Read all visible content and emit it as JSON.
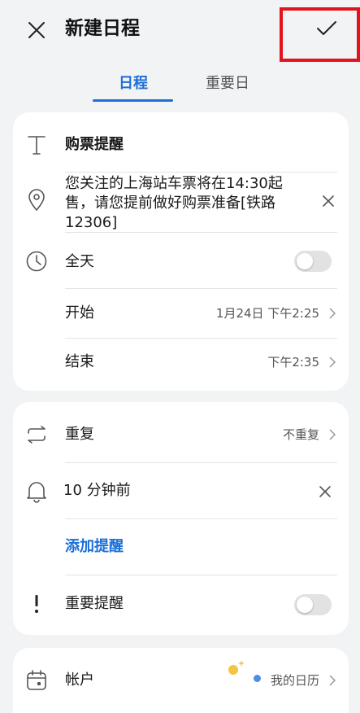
{
  "header": {
    "title": "新建日程"
  },
  "tabs": [
    {
      "label": "日程",
      "active": true
    },
    {
      "label": "重要日",
      "active": false
    }
  ],
  "event": {
    "title": "购票提醒",
    "location": "您关注的上海站车票将在14:30起售，请您提前做好购票准备[铁路12306]",
    "all_day_label": "全天",
    "all_day_enabled": false,
    "start_label": "开始",
    "start_value": "1月24日 下午2:25",
    "end_label": "结束",
    "end_value": "下午2:35"
  },
  "options": {
    "repeat_label": "重复",
    "repeat_value": "不重复",
    "reminder_value": "10 分钟前",
    "add_reminder_label": "添加提醒",
    "important_label": "重要提醒",
    "important_enabled": false
  },
  "account": {
    "label": "帐户",
    "value": "我的日历",
    "dot_color": "#4a90e2"
  },
  "colors": {
    "accent": "#1c6ed8",
    "highlight_box": "#e3121c",
    "background": "#f1f3f5"
  }
}
